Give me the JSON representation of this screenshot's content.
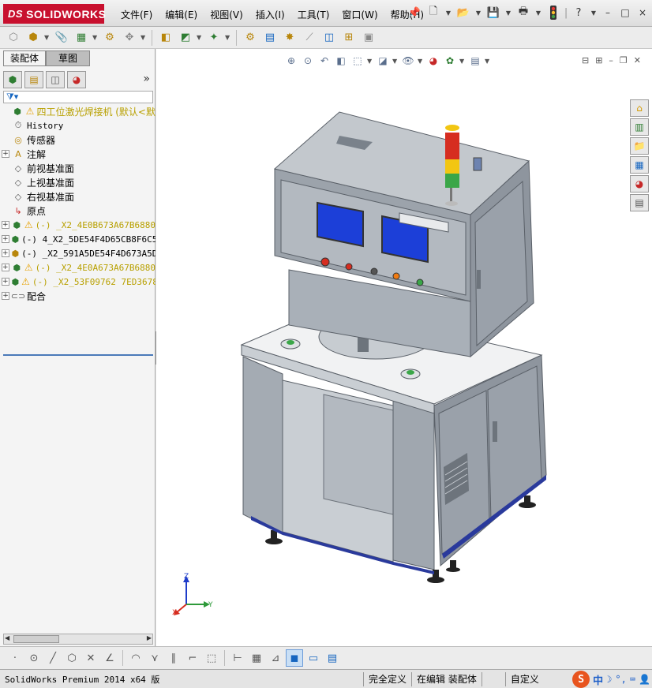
{
  "app": {
    "logo_prefix": "DS",
    "logo_text": "SOLIDWORKS"
  },
  "menu": [
    {
      "label": "文件(F)"
    },
    {
      "label": "编辑(E)"
    },
    {
      "label": "视图(V)"
    },
    {
      "label": "插入(I)"
    },
    {
      "label": "工具(T)"
    },
    {
      "label": "窗口(W)"
    },
    {
      "label": "帮助(H)"
    }
  ],
  "window_controls": [
    "–",
    "□",
    "×"
  ],
  "left_panel": {
    "tabs": [
      {
        "label": "装配体"
      },
      {
        "label": "草图"
      }
    ],
    "tree": [
      {
        "label": "四工位激光焊接机 (默认<默",
        "style": "yellow",
        "warn": true,
        "expand": "none",
        "icon": "assembly-icon"
      },
      {
        "label": "History",
        "style": "mono",
        "warn": false,
        "expand": "none",
        "icon": "history-icon"
      },
      {
        "label": "传感器",
        "style": "normal",
        "warn": false,
        "expand": "none",
        "icon": "sensor-icon"
      },
      {
        "label": "注解",
        "style": "normal",
        "warn": false,
        "expand": "plus",
        "icon": "annotation-icon"
      },
      {
        "label": "前视基准面",
        "style": "normal",
        "warn": false,
        "expand": "none",
        "icon": "plane-icon"
      },
      {
        "label": "上视基准面",
        "style": "normal",
        "warn": false,
        "expand": "none",
        "icon": "plane-icon"
      },
      {
        "label": "右视基准面",
        "style": "normal",
        "warn": false,
        "expand": "none",
        "icon": "plane-icon"
      },
      {
        "label": "原点",
        "style": "normal",
        "warn": false,
        "expand": "none",
        "icon": "origin-icon"
      },
      {
        "label": "(-) _X2_4E0B673A67B6880",
        "style": "yellow-mono",
        "warn": true,
        "expand": "plus",
        "icon": "subassembly-icon"
      },
      {
        "label": "(-) 4_X2_5DE54F4D65CB8F6C5",
        "style": "mono",
        "warn": false,
        "expand": "plus",
        "icon": "subassembly-icon"
      },
      {
        "label": "(-) _X2_591A5DE54F4D673A5D",
        "style": "mono",
        "warn": false,
        "expand": "plus",
        "icon": "part-icon"
      },
      {
        "label": "(-) _X2_4E0A673A67B6880",
        "style": "yellow-mono",
        "warn": true,
        "expand": "plus",
        "icon": "subassembly-icon"
      },
      {
        "label": "(-) _X2_53F09762 7ED3678",
        "style": "yellow-mono",
        "warn": true,
        "expand": "plus",
        "icon": "subassembly-icon"
      },
      {
        "label": "配合",
        "style": "normal",
        "warn": false,
        "expand": "plus",
        "icon": "mates-icon"
      }
    ]
  },
  "status": {
    "product": "SolidWorks Premium 2014 x64 版",
    "definition": "完全定义",
    "editing": "在编辑 装配体",
    "units": "自定义"
  },
  "triad": {
    "z": "Z",
    "y": "Y",
    "x": "X"
  },
  "ime": {
    "logo": "S",
    "lang": "中"
  },
  "colors": {
    "logo_red": "#c8102e",
    "tree_warning": "#e6a100",
    "tree_yellow_text": "#b8a000",
    "machine_frame": "#a9b0b8",
    "machine_panel": "#8e96a0",
    "screen_blue": "#1c3fd8"
  }
}
